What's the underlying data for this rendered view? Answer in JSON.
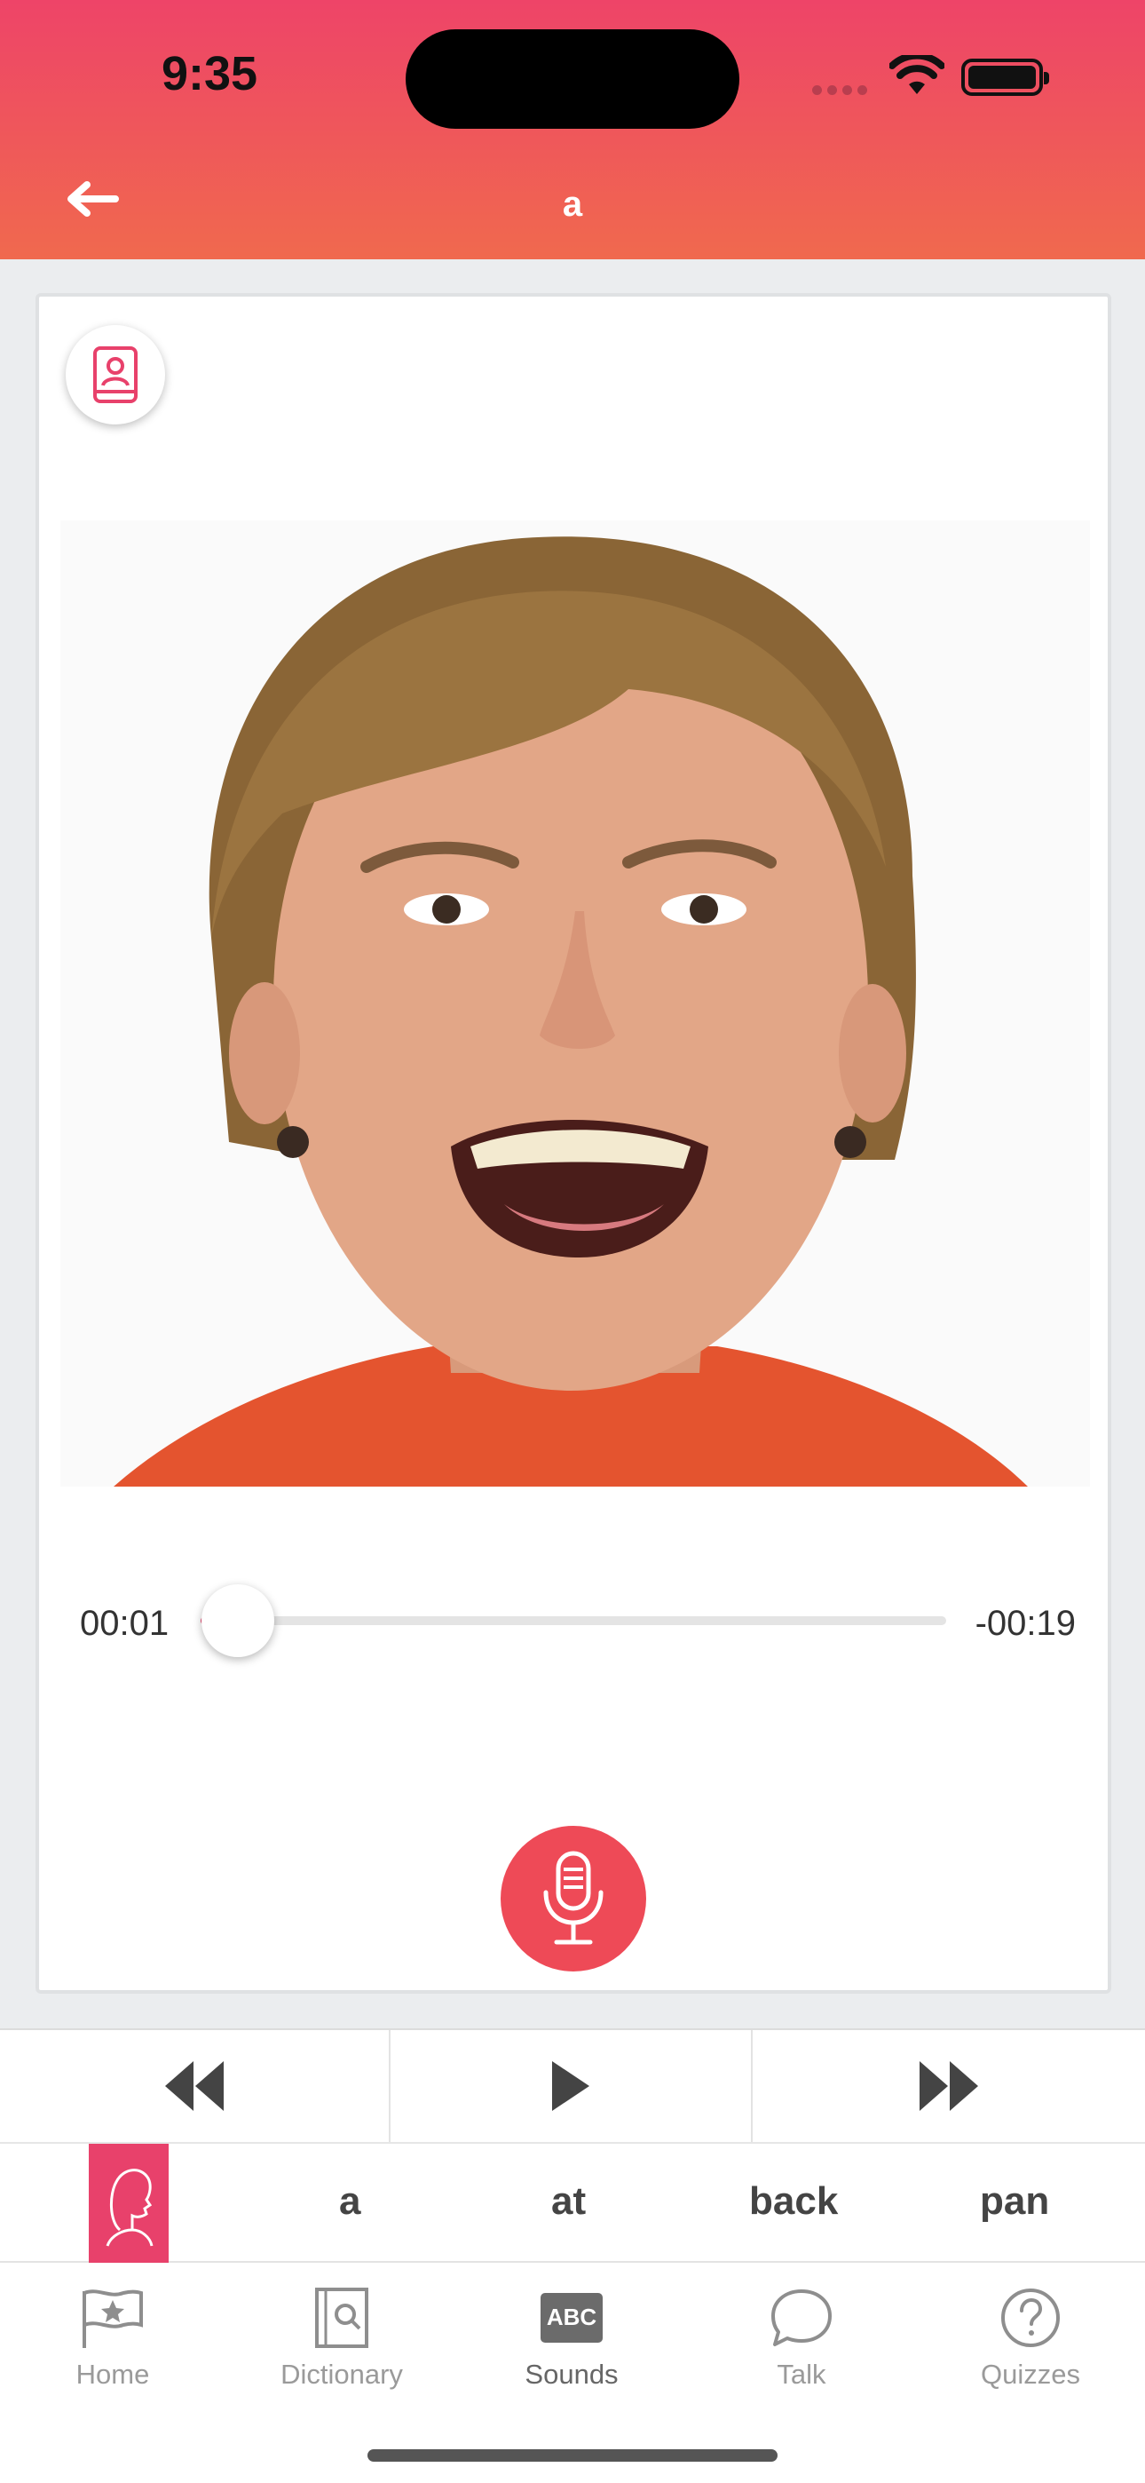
{
  "status_bar": {
    "time": "9:35"
  },
  "header": {
    "title": "a"
  },
  "player": {
    "elapsed": "00:01",
    "remaining": "-00:19",
    "progress": 0.05
  },
  "words": [
    "a",
    "at",
    "back",
    "pan"
  ],
  "tabs": [
    {
      "label": "Home",
      "icon": "flag-star-icon"
    },
    {
      "label": "Dictionary",
      "icon": "book-search-icon"
    },
    {
      "label": "Sounds",
      "icon": "abc-icon",
      "abc_text": "ABC",
      "active": true
    },
    {
      "label": "Talk",
      "icon": "chat-bubble-icon"
    },
    {
      "label": "Quizzes",
      "icon": "question-circle-icon"
    }
  ],
  "colors": {
    "accent": "#e8416b",
    "header_top": "#ee4468",
    "header_bottom": "#f0694e",
    "mic": "#ee4a57"
  }
}
